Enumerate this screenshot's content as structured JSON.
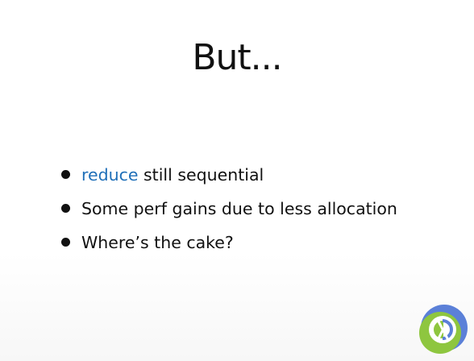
{
  "slide": {
    "title": "But...",
    "bullets": [
      {
        "highlight": "reduce",
        "text": " still sequential"
      },
      {
        "highlight": "",
        "text": "Some perf gains due to less allocation"
      },
      {
        "highlight": "",
        "text": "Where’s the cake?"
      }
    ]
  },
  "colors": {
    "text": "#111111",
    "keyword": "#1f6fb8",
    "logo_blue": "#5b80d8",
    "logo_green": "#8ec63f"
  },
  "logo": {
    "icon": "clojure-logo-icon"
  }
}
